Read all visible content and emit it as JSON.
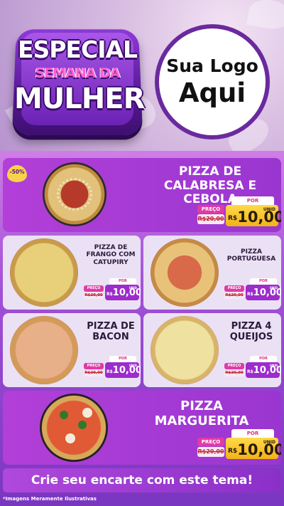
{
  "hero": {
    "badge_line1": "ESPECIAL",
    "badge_line2": "SEMANA DA",
    "badge_line3": "MULHER",
    "logo_line1": "Sua Logo",
    "logo_line2": "Aqui"
  },
  "discount_badge": "-50%",
  "items": [
    {
      "name": "PIZZA DE CALABRESA E CEBOLA",
      "label_price": "PREÇO",
      "old_price": "R$20,00",
      "label_por": "POR",
      "currency": "R$",
      "new_price": "10,00",
      "unit": "UNID"
    },
    {
      "name": "PIZZA DE FRANGO COM CATUPIRY",
      "label_price": "PREÇO",
      "old_price": "R$20,00",
      "label_por": "POR",
      "currency": "R$",
      "new_price": "10,00",
      "unit": "UNID"
    },
    {
      "name": "PIZZA PORTUGUESA",
      "label_price": "PREÇO",
      "old_price": "R$20,00",
      "label_por": "POR",
      "currency": "R$",
      "new_price": "10,00",
      "unit": "UNID"
    },
    {
      "name": "PIZZA DE BACON",
      "label_price": "PREÇO",
      "old_price": "R$20,00",
      "label_por": "POR",
      "currency": "R$",
      "new_price": "10,00",
      "unit": "UNID"
    },
    {
      "name": "PIZZA 4 QUEIJOS",
      "label_price": "PREÇO",
      "old_price": "R$20,00",
      "label_por": "POR",
      "currency": "R$",
      "new_price": "10,00",
      "unit": "UNID"
    },
    {
      "name": "PIZZA MARGUERITA",
      "label_price": "PREÇO",
      "old_price": "R$20,00",
      "label_por": "POR",
      "currency": "R$",
      "new_price": "10,00",
      "unit": "UNID"
    }
  ],
  "cta": "Crie seu encarte com este tema!",
  "footnote": "*Imagens Meramente Ilustrativas",
  "colors": {
    "primary_purple": "#9a36d0",
    "accent_pink": "#e03aa6",
    "price_yellow": "#ffd94a"
  }
}
